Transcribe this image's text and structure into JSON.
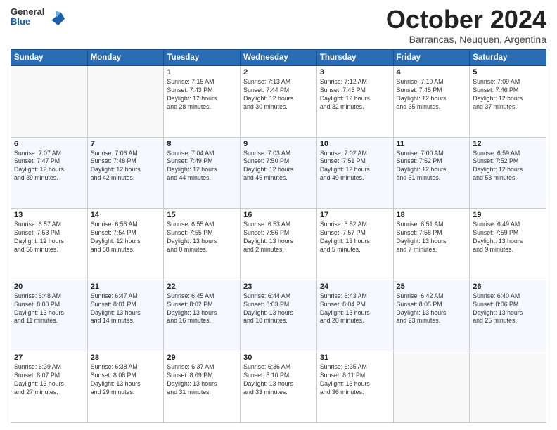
{
  "header": {
    "logo_general": "General",
    "logo_blue": "Blue",
    "title": "October 2024",
    "location": "Barrancas, Neuquen, Argentina"
  },
  "days_of_week": [
    "Sunday",
    "Monday",
    "Tuesday",
    "Wednesday",
    "Thursday",
    "Friday",
    "Saturday"
  ],
  "weeks": [
    [
      {
        "day": "",
        "info": ""
      },
      {
        "day": "",
        "info": ""
      },
      {
        "day": "1",
        "info": "Sunrise: 7:15 AM\nSunset: 7:43 PM\nDaylight: 12 hours\nand 28 minutes."
      },
      {
        "day": "2",
        "info": "Sunrise: 7:13 AM\nSunset: 7:44 PM\nDaylight: 12 hours\nand 30 minutes."
      },
      {
        "day": "3",
        "info": "Sunrise: 7:12 AM\nSunset: 7:45 PM\nDaylight: 12 hours\nand 32 minutes."
      },
      {
        "day": "4",
        "info": "Sunrise: 7:10 AM\nSunset: 7:45 PM\nDaylight: 12 hours\nand 35 minutes."
      },
      {
        "day": "5",
        "info": "Sunrise: 7:09 AM\nSunset: 7:46 PM\nDaylight: 12 hours\nand 37 minutes."
      }
    ],
    [
      {
        "day": "6",
        "info": "Sunrise: 7:07 AM\nSunset: 7:47 PM\nDaylight: 12 hours\nand 39 minutes."
      },
      {
        "day": "7",
        "info": "Sunrise: 7:06 AM\nSunset: 7:48 PM\nDaylight: 12 hours\nand 42 minutes."
      },
      {
        "day": "8",
        "info": "Sunrise: 7:04 AM\nSunset: 7:49 PM\nDaylight: 12 hours\nand 44 minutes."
      },
      {
        "day": "9",
        "info": "Sunrise: 7:03 AM\nSunset: 7:50 PM\nDaylight: 12 hours\nand 46 minutes."
      },
      {
        "day": "10",
        "info": "Sunrise: 7:02 AM\nSunset: 7:51 PM\nDaylight: 12 hours\nand 49 minutes."
      },
      {
        "day": "11",
        "info": "Sunrise: 7:00 AM\nSunset: 7:52 PM\nDaylight: 12 hours\nand 51 minutes."
      },
      {
        "day": "12",
        "info": "Sunrise: 6:59 AM\nSunset: 7:52 PM\nDaylight: 12 hours\nand 53 minutes."
      }
    ],
    [
      {
        "day": "13",
        "info": "Sunrise: 6:57 AM\nSunset: 7:53 PM\nDaylight: 12 hours\nand 56 minutes."
      },
      {
        "day": "14",
        "info": "Sunrise: 6:56 AM\nSunset: 7:54 PM\nDaylight: 12 hours\nand 58 minutes."
      },
      {
        "day": "15",
        "info": "Sunrise: 6:55 AM\nSunset: 7:55 PM\nDaylight: 13 hours\nand 0 minutes."
      },
      {
        "day": "16",
        "info": "Sunrise: 6:53 AM\nSunset: 7:56 PM\nDaylight: 13 hours\nand 2 minutes."
      },
      {
        "day": "17",
        "info": "Sunrise: 6:52 AM\nSunset: 7:57 PM\nDaylight: 13 hours\nand 5 minutes."
      },
      {
        "day": "18",
        "info": "Sunrise: 6:51 AM\nSunset: 7:58 PM\nDaylight: 13 hours\nand 7 minutes."
      },
      {
        "day": "19",
        "info": "Sunrise: 6:49 AM\nSunset: 7:59 PM\nDaylight: 13 hours\nand 9 minutes."
      }
    ],
    [
      {
        "day": "20",
        "info": "Sunrise: 6:48 AM\nSunset: 8:00 PM\nDaylight: 13 hours\nand 11 minutes."
      },
      {
        "day": "21",
        "info": "Sunrise: 6:47 AM\nSunset: 8:01 PM\nDaylight: 13 hours\nand 14 minutes."
      },
      {
        "day": "22",
        "info": "Sunrise: 6:45 AM\nSunset: 8:02 PM\nDaylight: 13 hours\nand 16 minutes."
      },
      {
        "day": "23",
        "info": "Sunrise: 6:44 AM\nSunset: 8:03 PM\nDaylight: 13 hours\nand 18 minutes."
      },
      {
        "day": "24",
        "info": "Sunrise: 6:43 AM\nSunset: 8:04 PM\nDaylight: 13 hours\nand 20 minutes."
      },
      {
        "day": "25",
        "info": "Sunrise: 6:42 AM\nSunset: 8:05 PM\nDaylight: 13 hours\nand 23 minutes."
      },
      {
        "day": "26",
        "info": "Sunrise: 6:40 AM\nSunset: 8:06 PM\nDaylight: 13 hours\nand 25 minutes."
      }
    ],
    [
      {
        "day": "27",
        "info": "Sunrise: 6:39 AM\nSunset: 8:07 PM\nDaylight: 13 hours\nand 27 minutes."
      },
      {
        "day": "28",
        "info": "Sunrise: 6:38 AM\nSunset: 8:08 PM\nDaylight: 13 hours\nand 29 minutes."
      },
      {
        "day": "29",
        "info": "Sunrise: 6:37 AM\nSunset: 8:09 PM\nDaylight: 13 hours\nand 31 minutes."
      },
      {
        "day": "30",
        "info": "Sunrise: 6:36 AM\nSunset: 8:10 PM\nDaylight: 13 hours\nand 33 minutes."
      },
      {
        "day": "31",
        "info": "Sunrise: 6:35 AM\nSunset: 8:11 PM\nDaylight: 13 hours\nand 36 minutes."
      },
      {
        "day": "",
        "info": ""
      },
      {
        "day": "",
        "info": ""
      }
    ]
  ]
}
